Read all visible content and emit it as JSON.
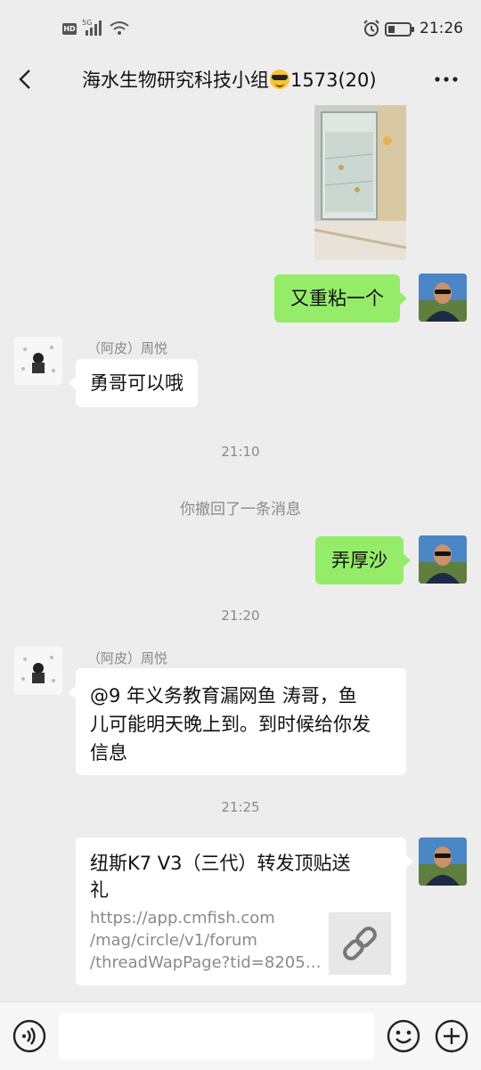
{
  "status_bar": {
    "hd_label": "HD",
    "network_label": "5G",
    "time": "21:26"
  },
  "header": {
    "title_prefix": "海水生物研究科技小组",
    "title_suffix": "1573(20)",
    "back_icon": "chevron-left-icon",
    "more_icon": "more-horizontal-icon"
  },
  "messages": {
    "m1": {
      "text": "又重粘一个"
    },
    "m2": {
      "sender": "（阿皮）周悦",
      "text": "勇哥可以哦"
    },
    "t1": "21:10",
    "recall": "你撤回了一条消息",
    "m3": {
      "text": "弄厚沙"
    },
    "t2": "21:20",
    "m4": {
      "sender": "（阿皮）周悦",
      "line1": "@9 年义务教育漏网鱼  涛哥，鱼",
      "line2": "儿可能明天晚上到。到时候给你发",
      "line3": "信息"
    },
    "t3": "21:25",
    "card": {
      "title_line1": "纽斯K7 V3（三代）转发顶贴送",
      "title_line2": "礼",
      "url_line1": "https://app.cmfish.com",
      "url_line2": "/mag/circle/v1/forum",
      "url_line3": "/threadWapPage?tid=8205…",
      "thumb_icon": "link-icon"
    }
  },
  "input_bar": {
    "voice_icon": "voice-icon",
    "emoji_icon": "emoji-icon",
    "plus_icon": "plus-icon"
  },
  "colors": {
    "background": "#ededed",
    "my_bubble": "#95ec69",
    "other_bubble": "#ffffff"
  }
}
